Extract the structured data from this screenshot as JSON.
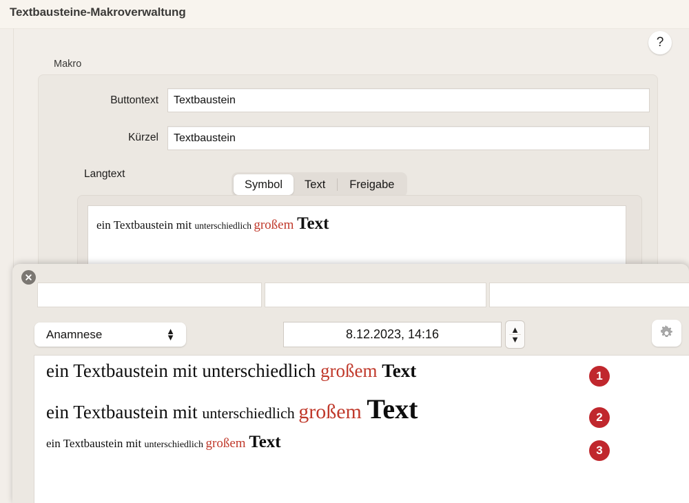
{
  "window": {
    "title": "Textbausteine-Makroverwaltung",
    "help_label": "?"
  },
  "makro": {
    "group_label": "Makro",
    "fields": [
      {
        "label": "Buttontext",
        "value": "Textbaustein",
        "placeholder": ""
      },
      {
        "label": "Kürzel",
        "value": "Textbaustein",
        "placeholder": ""
      }
    ],
    "langtext_label": "Langtext",
    "segmented": {
      "options": [
        "Symbol",
        "Text",
        "Freigabe"
      ],
      "selected": "Symbol"
    },
    "preview": {
      "run1": "ein Textbaustein mit ",
      "run2": "unterschiedlich ",
      "run3": "großem ",
      "run4": "Text"
    }
  },
  "overlay": {
    "close_label": "close-icon",
    "fields": [
      {
        "value": "",
        "placeholder": ""
      },
      {
        "value": "",
        "placeholder": ""
      },
      {
        "value": "",
        "placeholder": ""
      }
    ],
    "category_dropdown": {
      "selected": "Anamnese",
      "options": [
        "Anamnese"
      ]
    },
    "date": {
      "value": "8.12.2023, 14:16",
      "placeholder": ""
    },
    "gear_label": "gear-icon",
    "document_lines": [
      {
        "badge": "1",
        "run1": "ein Textbaustein mit ",
        "run2": "unterschiedlich ",
        "run3": "großem ",
        "run4": "Text"
      },
      {
        "badge": "2",
        "run1": "ein Textbaustein mit ",
        "run2": "unterschiedlich ",
        "run3": "großem ",
        "run4": "Text"
      },
      {
        "badge": "3",
        "run1": "ein Textbaustein mit ",
        "run2": "unterschiedlich ",
        "run3": "großem ",
        "run4": "Text"
      }
    ]
  },
  "colors": {
    "accent_red": "#C0272D",
    "text_red": "#C0392B",
    "window_bg": "#F2EEE9",
    "header_bg": "#F8F4EE",
    "group_bg": "#ECE8E2"
  }
}
